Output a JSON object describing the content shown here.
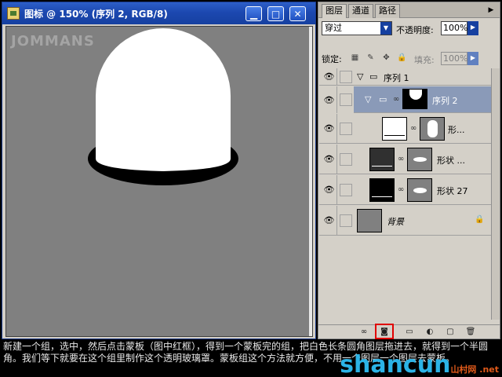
{
  "document": {
    "title": "图标 @ 150% (序列 2, RGB/8)",
    "watermark": "JOMMANS",
    "window_buttons": [
      "▁",
      "□",
      "✕"
    ]
  },
  "layers_panel": {
    "tabs": [
      "图层",
      "通道",
      "路径"
    ],
    "blend_mode": "穿过",
    "opacity_label": "不透明度:",
    "opacity_value": "100%",
    "lock_label": "锁定:",
    "fill_label": "填充:",
    "fill_value": "100%",
    "layers": [
      {
        "name": "序列 1",
        "type": "group"
      },
      {
        "name": "序列 2",
        "type": "group",
        "selected": true
      },
      {
        "name": "形..."
      },
      {
        "name": "形状 ..."
      },
      {
        "name": "形状 27"
      },
      {
        "name": "背景",
        "locked": true
      }
    ]
  },
  "caption": {
    "text": "新建一个组，选中，然后点击蒙板（图中红框），得到一个蒙板完的组，把白色长条圆角图层拖进去，就得到一个半圆角。我们等下就要在这个组里制作这个透明玻璃罩。蒙板组这个方法就方便，不用一个图层一个图层去蒙板。",
    "logo": "shancun",
    "logo_suffix": "山村网 .net"
  },
  "colors": {
    "title_blue": "#1c48b0",
    "canvas_gray": "#808080",
    "highlight_red": "#e00000"
  }
}
